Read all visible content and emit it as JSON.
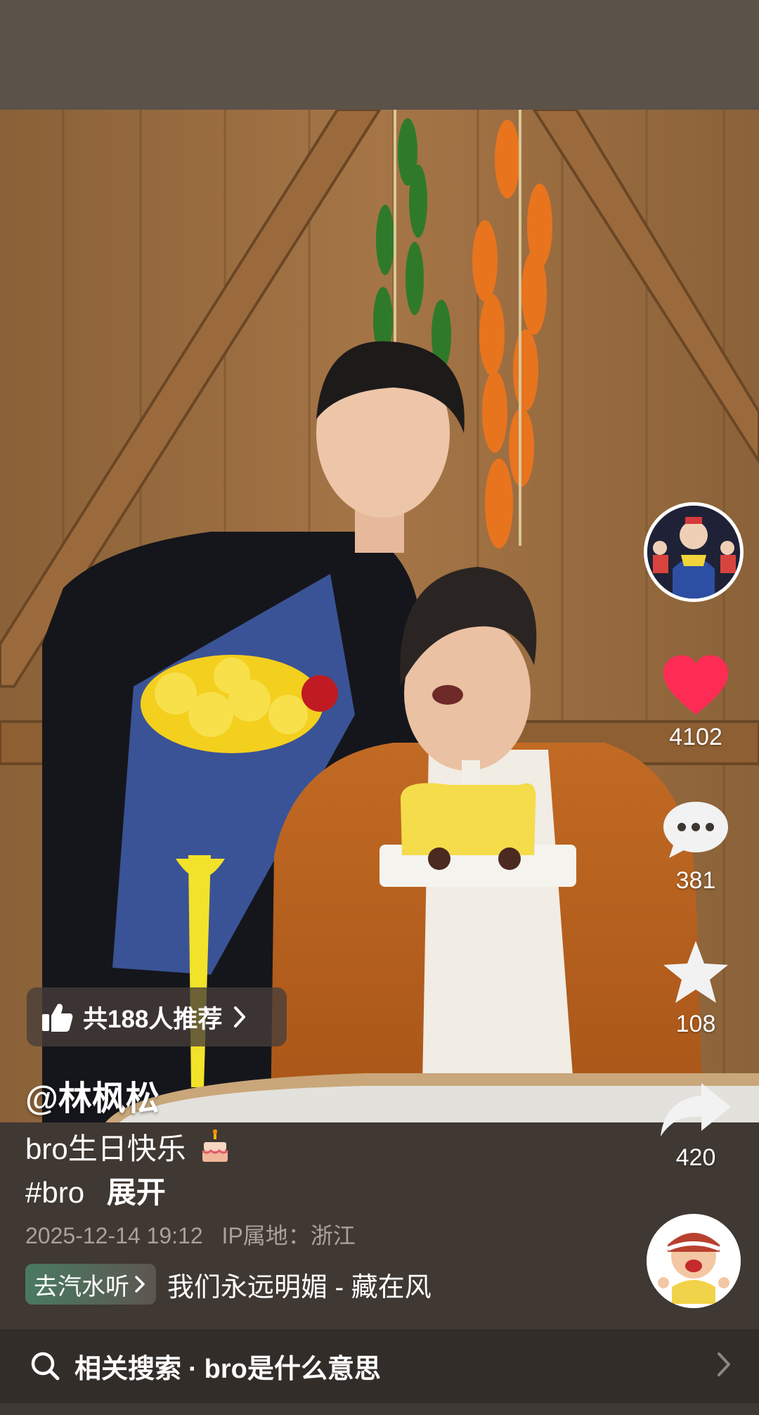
{
  "post": {
    "author": "@林枫松",
    "caption": "bro生日快乐",
    "hashtag": "#bro",
    "expand_label": "展开",
    "date": "2025-12-14 19:12",
    "ip_location": "IP属地：浙江"
  },
  "recommend": {
    "label": "共188人推荐"
  },
  "actions": {
    "likes": "4102",
    "comments": "381",
    "favorites": "108",
    "shares": "420"
  },
  "music": {
    "chip_label": "去汽水听",
    "title": "我们永远明媚 - 藏在风"
  },
  "related_search": {
    "prefix": "相关搜索",
    "separator": "·",
    "query": "bro是什么意思"
  },
  "colors": {
    "like_heart": "#fe2c55",
    "music_chip_start": "#4a7a62"
  },
  "icons": {
    "recommend": "thumbs-up-icon",
    "like": "heart-icon",
    "comment": "comment-bubble-icon",
    "favorite": "star-icon",
    "share": "share-arrow-icon",
    "search": "search-icon",
    "chevron": "chevron-right-icon",
    "caption_emoji": "birthday-cake-emoji"
  }
}
